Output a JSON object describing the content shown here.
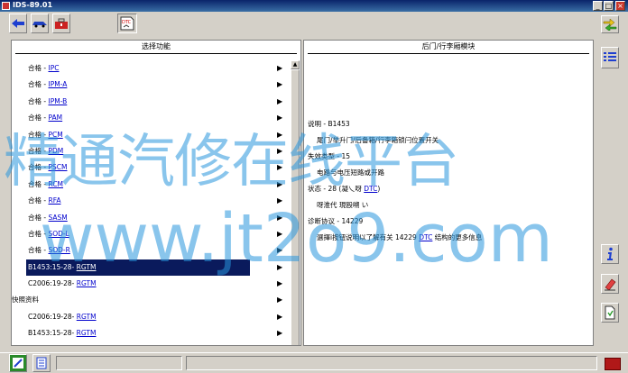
{
  "window": {
    "title": "IDS-89.01"
  },
  "toolbar": {
    "dtc_label": "DTC"
  },
  "left_panel": {
    "header": "选择功能",
    "rows": [
      {
        "prefix": "合格 - ",
        "link": "IPC"
      },
      {
        "prefix": "合格 - ",
        "link": "IPM-A"
      },
      {
        "prefix": "合格 - ",
        "link": "IPM-B"
      },
      {
        "prefix": "合格 - ",
        "link": "PAM"
      },
      {
        "prefix": "合格 - ",
        "link": "PCM"
      },
      {
        "prefix": "合格 - ",
        "link": "PDM"
      },
      {
        "prefix": "合格 - ",
        "link": "PSCM"
      },
      {
        "prefix": "合格 - ",
        "link": "RCM"
      },
      {
        "prefix": "合格 - ",
        "link": "RFA"
      },
      {
        "prefix": "合格 - ",
        "link": "SASM"
      },
      {
        "prefix": "合格 - ",
        "link": "SOD-L"
      },
      {
        "prefix": "合格 - ",
        "link": "SOD-R"
      },
      {
        "prefix": "B1453:15-28- ",
        "link": "RGTM"
      },
      {
        "prefix": "C2006:19-28- ",
        "link": "RGTM"
      },
      {
        "prefix": "快照资料",
        "link": ""
      },
      {
        "prefix": "C2006:19-28- ",
        "link": "RGTM"
      },
      {
        "prefix": "B1453:15-28- ",
        "link": "RGTM"
      }
    ]
  },
  "right_panel": {
    "header": "后门/行李厢模块",
    "lines": [
      {
        "text": "说明 - B1453",
        "link": "",
        "tail": ""
      },
      {
        "text": "尾门/举升门/后备箱/行李箱锁闩位置开关",
        "link": "",
        "tail": ""
      },
      {
        "text": "失效类型 - 15",
        "link": "",
        "tail": ""
      },
      {
        "text": "电路与电压短路或开路",
        "link": "",
        "tail": ""
      },
      {
        "text": "状态 - 28 (凝乀呀 ",
        "link": "DTC",
        "tail": ")"
      },
      {
        "text": "呀淮代    現殴嗍    い",
        "link": "",
        "tail": ""
      },
      {
        "text": "诊断协议 - 14229",
        "link": "",
        "tail": ""
      },
      {
        "text": "選擇i按钮说明以了解有关 14229 ",
        "link": "DTC",
        "tail": " 结构的更多信息"
      }
    ]
  },
  "watermark": {
    "line1": "精通汽修在线平台",
    "line2": "www.jt2o9.com"
  },
  "colors": {
    "link": "#0000cc",
    "selected_row": "#0a1a5c",
    "title_bar": "#0a246a",
    "watermark": "#2896dc"
  }
}
